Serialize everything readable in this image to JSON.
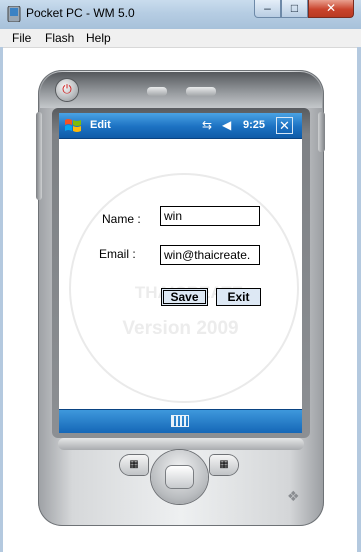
{
  "window": {
    "title": "Pocket PC - WM 5.0",
    "minimize_label": "–",
    "maximize_label": "□",
    "close_label": "✕"
  },
  "menubar": {
    "items": [
      "File",
      "Flash",
      "Help"
    ]
  },
  "device": {
    "power_icon": "power-icon",
    "statusbar": {
      "title": "Edit",
      "time": "9:25",
      "connectivity_glyph": "⇆",
      "speaker_glyph": "◀",
      "close_label": "✕"
    },
    "watermark": {
      "brand": "THAICREATE",
      "version": "Version 2009"
    },
    "form": {
      "name_label": "Name :",
      "name_value": "win",
      "email_label": "Email :",
      "email_value": "win@thaicreate.",
      "save_label": "Save",
      "exit_label": "Exit"
    },
    "hardware": {
      "soft_left_icon": "calendar-icon",
      "soft_right_icon": "contacts-icon",
      "logo_icon": "windows-flag-icon"
    }
  },
  "colors": {
    "titlebar": "#b6cde3",
    "statusbar": "#1c71c2",
    "button": "#dde8f4",
    "close": "#c9442d"
  }
}
